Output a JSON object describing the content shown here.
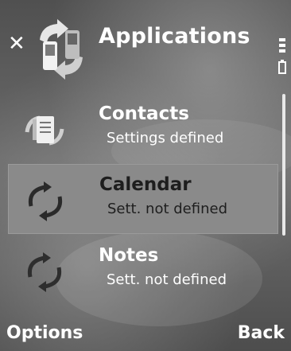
{
  "header": {
    "title": "Applications",
    "close_icon": "close-icon",
    "app_icon": "sync-applications-icon"
  },
  "list": {
    "items": [
      {
        "label": "Contacts",
        "status": "Settings defined",
        "icon": "contacts-sync-icon",
        "selected": false
      },
      {
        "label": "Calendar",
        "status": "Sett. not defined",
        "icon": "sync-icon",
        "selected": true
      },
      {
        "label": "Notes",
        "status": "Sett. not defined",
        "icon": "sync-icon",
        "selected": false
      }
    ]
  },
  "softkeys": {
    "left": "Options",
    "right": "Back"
  },
  "colors": {
    "background": "#5b5b5b",
    "highlight": "#8a8a8a",
    "text": "#ffffff",
    "selected_text": "#1e1e1e"
  }
}
